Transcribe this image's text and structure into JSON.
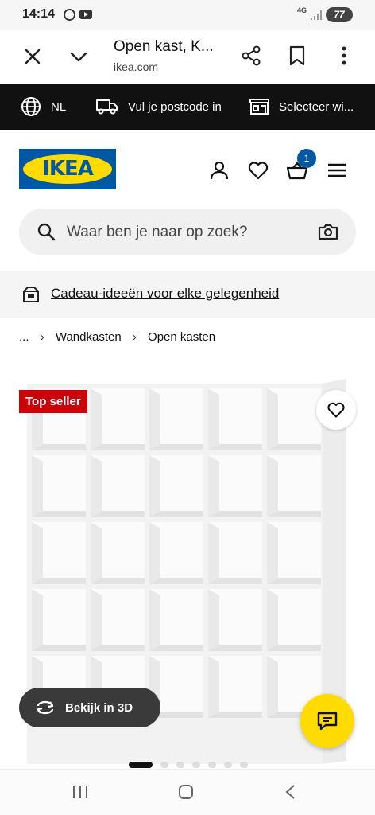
{
  "status_bar": {
    "time": "14:14",
    "network": "4G",
    "battery": "77",
    "icons": [
      "whatsapp-icon",
      "youtube-icon",
      "signal-icon",
      "battery-icon"
    ]
  },
  "browser": {
    "page_title": "Open kast, K...",
    "url": "ikea.com",
    "icons": [
      "close-icon",
      "chevron-down-icon",
      "share-icon",
      "bookmark-icon",
      "more-vertical-icon"
    ]
  },
  "info_strip": {
    "language": "NL",
    "postcode": "Vul je postcode in",
    "store": "Selecteer wi..."
  },
  "header": {
    "logo_text": "IKEA",
    "cart_count": "1",
    "brand_blue": "#0058a3",
    "brand_yellow": "#ffdb00"
  },
  "search": {
    "placeholder": "Waar ben je naar op zoek?"
  },
  "promo": {
    "link": "Cadeau-ideeën voor elke gelegenheid"
  },
  "breadcrumb": {
    "ellipsis": "...",
    "items": [
      "Wandkasten",
      "Open kasten"
    ]
  },
  "product": {
    "badge": "Top seller",
    "badge_color": "#cc0008",
    "view_3d": "Bekijk in 3D",
    "image_count": 7,
    "active_image": 1
  }
}
